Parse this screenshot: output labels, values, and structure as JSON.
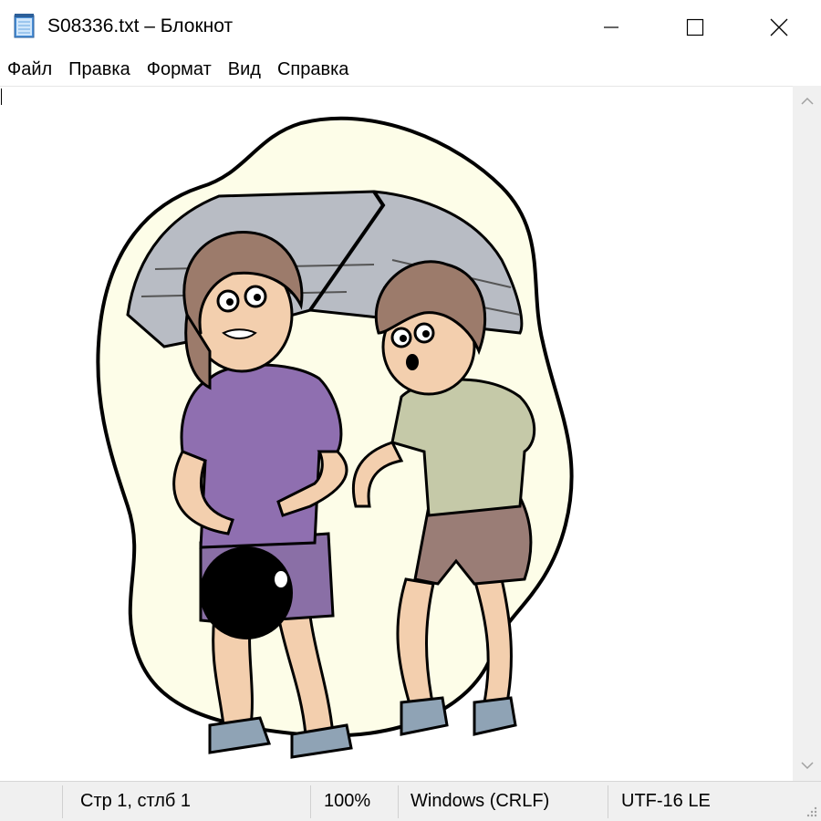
{
  "window": {
    "title": "S08336.txt – Блокнот"
  },
  "icons": {
    "app": "notepad-icon",
    "minimize": "minimize-icon",
    "maximize": "maximize-icon",
    "close": "close-icon",
    "scroll_up": "chevron-up-icon",
    "scroll_down": "chevron-down-icon",
    "resize": "resize-grip-icon"
  },
  "menu": {
    "items": [
      "Файл",
      "Правка",
      "Формат",
      "Вид",
      "Справка"
    ]
  },
  "status": {
    "position": "Стр 1, стлб 1",
    "zoom": "100%",
    "line_ending": "Windows (CRLF)",
    "encoding": "UTF-16 LE"
  }
}
